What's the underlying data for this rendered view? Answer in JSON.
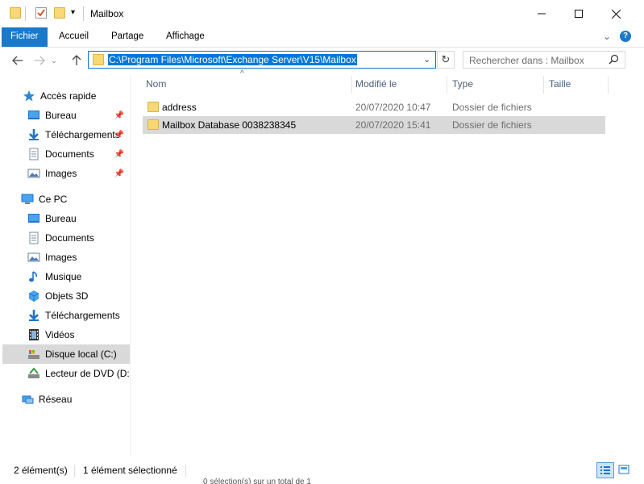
{
  "window": {
    "title": "Mailbox"
  },
  "ribbon": {
    "tabs": [
      "Fichier",
      "Accueil",
      "Partage",
      "Affichage"
    ]
  },
  "address": {
    "path": "C:\\Program Files\\Microsoft\\Exchange Server\\V15\\Mailbox"
  },
  "search": {
    "placeholder": "Rechercher dans : Mailbox"
  },
  "sidebar": {
    "quick_access": "Accès rapide",
    "quick_items": [
      "Bureau",
      "Téléchargements",
      "Documents",
      "Images"
    ],
    "this_pc": "Ce PC",
    "pc_items": [
      "Bureau",
      "Documents",
      "Images",
      "Musique",
      "Objets 3D",
      "Téléchargements",
      "Vidéos",
      "Disque local (C:)",
      "Lecteur de DVD (D:)"
    ],
    "network": "Réseau"
  },
  "columns": {
    "name": "Nom",
    "modified": "Modifié le",
    "type": "Type",
    "size": "Taille"
  },
  "files": [
    {
      "name": "address",
      "modified": "20/07/2020 10:47",
      "type": "Dossier de fichiers"
    },
    {
      "name": "Mailbox Database 0038238345",
      "modified": "20/07/2020 15:41",
      "type": "Dossier de fichiers"
    }
  ],
  "status": {
    "count": "2 élément(s)",
    "selected": "1 élément sélectionné",
    "ghost": "0 sélection(s) sur un total de 1"
  },
  "colors": {
    "accent": "#1979ca",
    "selection": "#d9d9d9",
    "folder": "#f8d775"
  }
}
